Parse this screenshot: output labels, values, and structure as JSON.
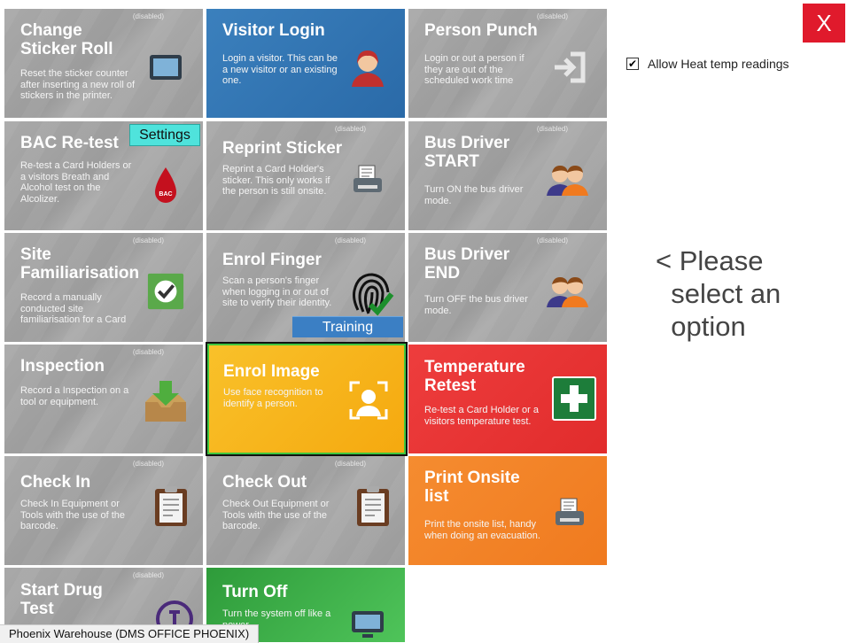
{
  "close_button": {
    "label": "X"
  },
  "options": {
    "allow_heat_label": "Allow Heat temp readings",
    "allow_heat_checked": true,
    "check_glyph": "✔"
  },
  "prompt": {
    "text": "< Please\n  select an\n  option"
  },
  "status_bar": {
    "text": "Phoenix Warehouse (DMS OFFICE PHOENIX)"
  },
  "disabled_tag": "(disabled)",
  "tiles": {
    "change_sticker_roll": {
      "title": "Change Sticker Roll",
      "desc": "Reset the sticker counter after inserting a new roll of stickers in the printer.",
      "icon": "tablet-icon"
    },
    "visitor_login": {
      "title": "Visitor Login",
      "desc": "Login a visitor. This can be a new visitor or an existing one.",
      "icon": "visitor-avatar-icon"
    },
    "person_punch": {
      "title": "Person Punch",
      "desc": "Login or out a person if they are out of the scheduled work time",
      "icon": "sign-in-icon"
    },
    "bac_retest": {
      "title": "BAC Re-test",
      "desc": "Re-test a Card Holders or a visitors Breath and Alcohol test on the Alcolizer.",
      "icon": "blood-drop-icon",
      "icon_text": "BAC"
    },
    "reprint_sticker": {
      "title": "Reprint Sticker",
      "desc": "Reprint a Card Holder's sticker. This only works if the person is still onsite.",
      "icon": "printer-icon"
    },
    "bus_driver_start": {
      "title": "Bus Driver START",
      "desc": "Turn ON the bus driver mode.",
      "icon": "people-icon"
    },
    "site_familiarisation": {
      "title": "Site Familiarisation",
      "desc": "Record a manually conducted site familiarisation for a Card",
      "icon": "checkmark-box-icon"
    },
    "enrol_finger": {
      "title": "Enrol Finger",
      "desc": "Scan a person's finger when logging in or out of site to verify their identity.",
      "icon": "fingerprint-icon"
    },
    "bus_driver_end": {
      "title": "Bus Driver END",
      "desc": "Turn OFF the bus driver mode.",
      "icon": "people-icon"
    },
    "inspection": {
      "title": "Inspection",
      "desc": "Record a Inspection on a tool or equipment.",
      "icon": "inbox-download-icon"
    },
    "enrol_image": {
      "title": "Enrol Image",
      "desc": "Use face recognition to identify a person.",
      "icon": "face-scan-icon"
    },
    "temperature_retest": {
      "title": "Temperature Retest",
      "desc": "Re-test a Card Holder or a visitors temperature test.",
      "icon": "first-aid-icon"
    },
    "check_in": {
      "title": "Check In",
      "desc": "Check In Equipment or Tools with the use of the barcode.",
      "icon": "clipboard-icon"
    },
    "check_out": {
      "title": "Check Out",
      "desc": "Check Out Equipment or Tools with the use of the barcode.",
      "icon": "clipboard-icon"
    },
    "print_onsite_list": {
      "title": "Print Onsite list",
      "desc": "Print the onsite list, handy when doing an evacuation.",
      "icon": "printer-icon"
    },
    "start_drug_test": {
      "title": "Start Drug Test",
      "desc": "",
      "icon": "drug-test-icon"
    },
    "turn_off": {
      "title": "Turn Off",
      "desc": "Turn the system off like a power",
      "icon": "monitor-icon"
    }
  },
  "badges": {
    "settings": "Settings",
    "training": "Training"
  },
  "colors": {
    "blue": "#3b80bd",
    "yellow": "#f9c12a",
    "red": "#e12c2c",
    "orange": "#f07a1f",
    "green": "#2e9b3a",
    "gray": "#a0a0a0",
    "close": "#e01a2c"
  }
}
